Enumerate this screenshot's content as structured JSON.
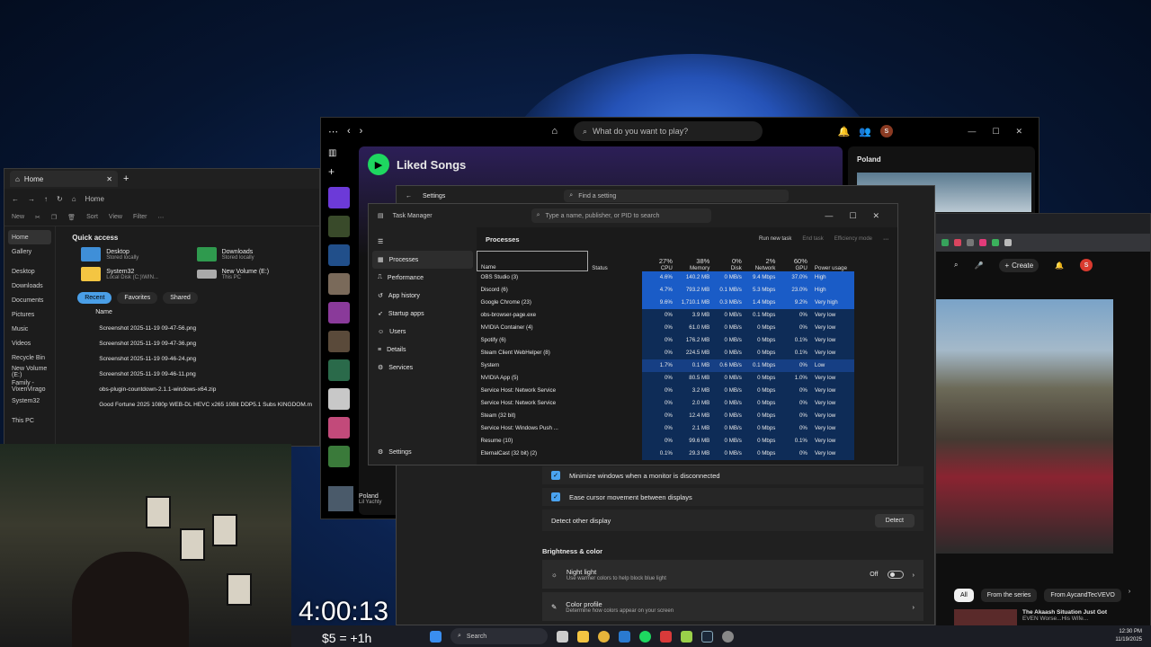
{
  "explorer": {
    "tab_title": "Home",
    "crumb": "Home",
    "cmd": {
      "new": "New",
      "sort": "Sort",
      "view": "View",
      "filter": "Filter"
    },
    "sidebar": [
      "Home",
      "Gallery",
      "Desktop",
      "Downloads",
      "Documents",
      "Pictures",
      "Music",
      "Videos",
      "Recycle Bin",
      "New Volume (E:)",
      "Family - VixenVirago",
      "System32",
      "This PC"
    ],
    "quick_access": "Quick access",
    "qa": [
      {
        "name": "Desktop",
        "sub": "Stored locally"
      },
      {
        "name": "Downloads",
        "sub": "Stored locally"
      },
      {
        "name": "System32",
        "sub": "Local Disk (C:)\\WIN..."
      },
      {
        "name": "New Volume (E:)",
        "sub": "This PC"
      }
    ],
    "pills": [
      "Recent",
      "Favorites",
      "Shared"
    ],
    "col_name": "Name",
    "files": [
      "Screenshot 2025-11-19 09-47-56.png",
      "Screenshot 2025-11-19 09-47-36.png",
      "Screenshot 2025-11-19 09-46-24.png",
      "Screenshot 2025-11-19 09-46-11.png",
      "obs-plugin-countdown-2.1.1-windows-x64.zip",
      "Good Fortune 2025 1080p WEB-DL HEVC x265 10Bit DDP5.1 Subs KINGDOM.m"
    ]
  },
  "spotify": {
    "search_placeholder": "What do you want to play?",
    "playlist_title": "Liked Songs",
    "right_title": "Poland",
    "now_playing_title": "Poland",
    "now_playing_artist": "Lil Yachty",
    "avatar_letter": "S"
  },
  "settings": {
    "title": "Settings",
    "search_placeholder": "Find a setting",
    "minimize_label": "Minimize windows when a monitor is disconnected",
    "ease_label": "Ease cursor movement between displays",
    "detect_label": "Detect other display",
    "detect_button": "Detect",
    "section": "Brightness & color",
    "night_light": "Night light",
    "night_light_desc": "Use warmer colors to help block blue light",
    "night_light_state": "Off",
    "color_profile": "Color profile",
    "color_profile_desc": "Determine how colors appear on your screen"
  },
  "taskmgr": {
    "title": "Task Manager",
    "search_placeholder": "Type a name, publisher, or PID to search",
    "nav": [
      "Processes",
      "Performance",
      "App history",
      "Startup apps",
      "Users",
      "Details",
      "Services"
    ],
    "nav_settings": "Settings",
    "heading": "Processes",
    "actions": [
      "Run new task",
      "End task",
      "Efficiency mode"
    ],
    "columns": {
      "name": "Name",
      "status": "Status",
      "cpu_pct": "27%",
      "cpu": "CPU",
      "mem_pct": "38%",
      "mem": "Memory",
      "disk_pct": "0%",
      "disk": "Disk",
      "net_pct": "2%",
      "net": "Network",
      "gpu_pct": "60%",
      "gpu": "GPU",
      "power": "Power usage"
    },
    "rows": [
      {
        "name": "OBS Studio (3)",
        "cpu": "4.6%",
        "mem": "140.2 MB",
        "disk": "0 MB/s",
        "net": "9.4 Mbps",
        "gpu": "37.0%",
        "power": "High",
        "heat": "hi"
      },
      {
        "name": "Discord (6)",
        "cpu": "4.7%",
        "mem": "793.2 MB",
        "disk": "0.1 MB/s",
        "net": "5.3 Mbps",
        "gpu": "23.0%",
        "power": "High",
        "heat": "hi"
      },
      {
        "name": "Google Chrome (23)",
        "cpu": "9.6%",
        "mem": "1,710.1 MB",
        "disk": "0.3 MB/s",
        "net": "1.4 Mbps",
        "gpu": "9.2%",
        "power": "Very high",
        "heat": "hi"
      },
      {
        "name": "obs-browser-page.exe",
        "cpu": "0%",
        "mem": "3.9 MB",
        "disk": "0 MB/s",
        "net": "0.1 Mbps",
        "gpu": "0%",
        "power": "Very low",
        "heat": "lo"
      },
      {
        "name": "NVIDIA Container (4)",
        "cpu": "0%",
        "mem": "61.0 MB",
        "disk": "0 MB/s",
        "net": "0 Mbps",
        "gpu": "0%",
        "power": "Very low",
        "heat": "lo"
      },
      {
        "name": "Spotify (6)",
        "cpu": "0%",
        "mem": "176.2 MB",
        "disk": "0 MB/s",
        "net": "0 Mbps",
        "gpu": "0.1%",
        "power": "Very low",
        "heat": "lo"
      },
      {
        "name": "Steam Client WebHelper (8)",
        "cpu": "0%",
        "mem": "224.5 MB",
        "disk": "0 MB/s",
        "net": "0 Mbps",
        "gpu": "0.1%",
        "power": "Very low",
        "heat": "lo"
      },
      {
        "name": "System",
        "cpu": "1.7%",
        "mem": "0.1 MB",
        "disk": "0.6 MB/s",
        "net": "0.1 Mbps",
        "gpu": "0%",
        "power": "Low",
        "heat": "mid"
      },
      {
        "name": "NVIDIA App (5)",
        "cpu": "0%",
        "mem": "80.5 MB",
        "disk": "0 MB/s",
        "net": "0 Mbps",
        "gpu": "1.0%",
        "power": "Very low",
        "heat": "lo"
      },
      {
        "name": "Service Host: Network Service",
        "cpu": "0%",
        "mem": "3.2 MB",
        "disk": "0 MB/s",
        "net": "0 Mbps",
        "gpu": "0%",
        "power": "Very low",
        "heat": "lo"
      },
      {
        "name": "Service Host: Network Service",
        "cpu": "0%",
        "mem": "2.0 MB",
        "disk": "0 MB/s",
        "net": "0 Mbps",
        "gpu": "0%",
        "power": "Very low",
        "heat": "lo"
      },
      {
        "name": "Steam (32 bit)",
        "cpu": "0%",
        "mem": "12.4 MB",
        "disk": "0 MB/s",
        "net": "0 Mbps",
        "gpu": "0%",
        "power": "Very low",
        "heat": "lo"
      },
      {
        "name": "Service Host: Windows Push ...",
        "cpu": "0%",
        "mem": "2.1 MB",
        "disk": "0 MB/s",
        "net": "0 Mbps",
        "gpu": "0%",
        "power": "Very low",
        "heat": "lo"
      },
      {
        "name": "Resume (10)",
        "cpu": "0%",
        "mem": "99.6 MB",
        "disk": "0 MB/s",
        "net": "0 Mbps",
        "gpu": "0.1%",
        "power": "Very low",
        "heat": "lo"
      },
      {
        "name": "EternalCast (32 bit) (2)",
        "cpu": "0.1%",
        "mem": "29.3 MB",
        "disk": "0 MB/s",
        "net": "0 Mbps",
        "gpu": "0%",
        "power": "Very low",
        "heat": "lo"
      }
    ]
  },
  "browser": {
    "create": "Create",
    "avatar_letter": "S",
    "chips": [
      "All",
      "From the series",
      "From AycandTecVEVO"
    ],
    "next_title": "The Akaash Situation Just Got",
    "next_sub": "EVEN Worse...His Wife..."
  },
  "overlay": {
    "timer": "4:00:13",
    "donation": "$5 = +1h"
  },
  "taskbar": {
    "search": "Search",
    "time": "12:30 PM",
    "date": "11/19/2025"
  }
}
